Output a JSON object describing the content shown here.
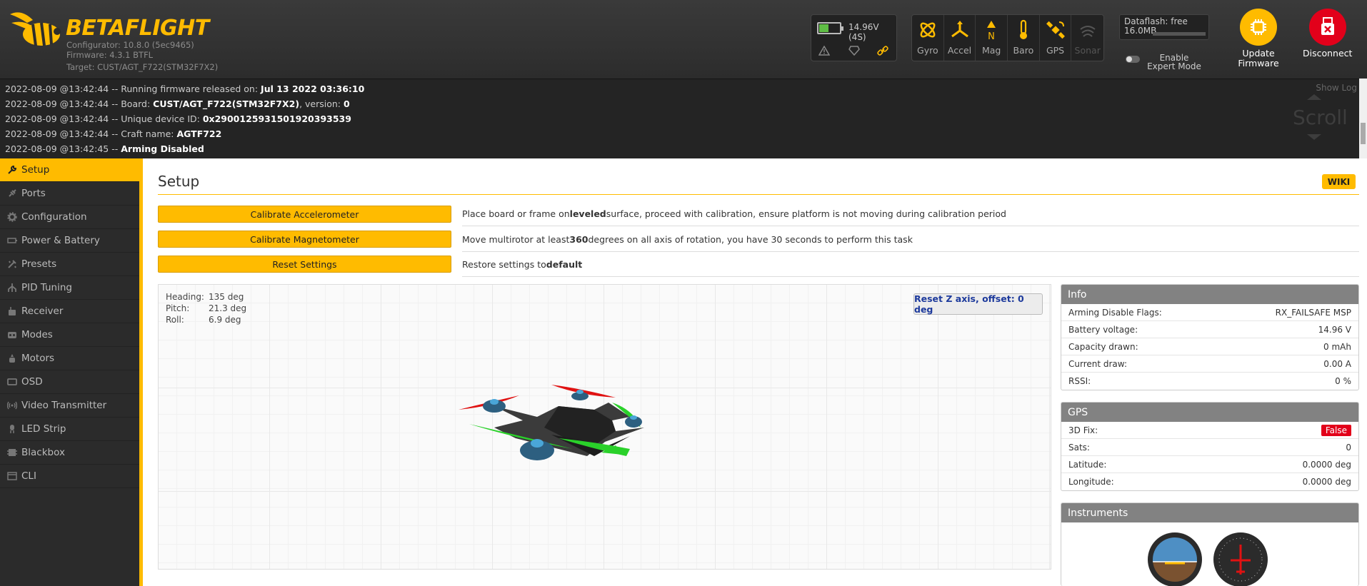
{
  "header": {
    "logo_name": "BETAFLIGHT",
    "configurator": "Configurator: 10.8.0 (5ec9465)",
    "firmware": "Firmware: 4.3.1 BTFL",
    "target": "Target: CUST/AGT_F722(STM32F7X2)",
    "battery": "14.96V (4S)",
    "sensors": [
      {
        "label": "Gyro"
      },
      {
        "label": "Accel"
      },
      {
        "label": "Mag"
      },
      {
        "label": "Baro"
      },
      {
        "label": "GPS"
      },
      {
        "label": "Sonar"
      }
    ],
    "dataflash_label": "Dataflash: free",
    "dataflash_size": "16.0MB",
    "expert_mode": "Enable Expert Mode",
    "update_firmware": "Update Firmware",
    "disconnect": "Disconnect",
    "accent_color": "#ffbb00",
    "disconnect_color": "#e2001a"
  },
  "log": {
    "show_log": "Show Log",
    "scroll": "Scroll",
    "lines": [
      {
        "prefix": "2022-08-09 @13:42:44 -- Running firmware released on: ",
        "bold": "Jul 13 2022 03:36:10",
        "suffix": ""
      },
      {
        "prefix": "2022-08-09 @13:42:44 -- Board: ",
        "bold": "CUST/AGT_F722(STM32F7X2)",
        "suffix": ", version: ",
        "bold2": "0"
      },
      {
        "prefix": "2022-08-09 @13:42:44 -- Unique device ID: ",
        "bold": "0x290012593150192039353​9",
        "suffix": ""
      },
      {
        "prefix": "2022-08-09 @13:42:44 -- Craft name: ",
        "bold": "AGTF722",
        "suffix": ""
      },
      {
        "prefix": "2022-08-09 @13:42:45 -- ",
        "bold": "Arming Disabled",
        "suffix": ""
      }
    ]
  },
  "sidebar": {
    "items": [
      {
        "label": "Setup",
        "icon": "wrench-icon"
      },
      {
        "label": "Ports",
        "icon": "plug-icon"
      },
      {
        "label": "Configuration",
        "icon": "gear-icon"
      },
      {
        "label": "Power & Battery",
        "icon": "battery-icon"
      },
      {
        "label": "Presets",
        "icon": "presets-icon"
      },
      {
        "label": "PID Tuning",
        "icon": "pid-icon"
      },
      {
        "label": "Receiver",
        "icon": "receiver-icon"
      },
      {
        "label": "Modes",
        "icon": "modes-icon"
      },
      {
        "label": "Motors",
        "icon": "motor-icon"
      },
      {
        "label": "OSD",
        "icon": "osd-icon"
      },
      {
        "label": "Video Transmitter",
        "icon": "antenna-icon"
      },
      {
        "label": "LED Strip",
        "icon": "led-icon"
      },
      {
        "label": "Blackbox",
        "icon": "blackbox-icon"
      },
      {
        "label": "CLI",
        "icon": "terminal-icon"
      }
    ]
  },
  "setup": {
    "title": "Setup",
    "wiki": "WIKI",
    "buttons": [
      {
        "label": "Calibrate Accelerometer",
        "desc_pre": "Place board or frame on ",
        "desc_bold": "leveled",
        "desc_post": " surface, proceed with calibration, ensure platform is not moving during calibration period"
      },
      {
        "label": "Calibrate Magnetometer",
        "desc_pre": "Move multirotor at least ",
        "desc_bold": "360",
        "desc_post": " degrees on all axis of rotation, you have 30 seconds to perform this task"
      },
      {
        "label": "Reset Settings",
        "desc_pre": "Restore settings to ",
        "desc_bold": "default",
        "desc_post": ""
      }
    ],
    "attitude": [
      {
        "label": "Heading:",
        "value": "135 deg"
      },
      {
        "label": "Pitch:",
        "value": "21.3 deg"
      },
      {
        "label": "Roll:",
        "value": "6.9 deg"
      }
    ],
    "reset_z": "Reset Z axis, offset: 0 deg"
  },
  "info": {
    "title": "Info",
    "rows": [
      {
        "label": "Arming Disable Flags:",
        "value": "RX_FAILSAFE  MSP"
      },
      {
        "label": "Battery voltage:",
        "value": "14.96 V"
      },
      {
        "label": "Capacity drawn:",
        "value": "0 mAh"
      },
      {
        "label": "Current draw:",
        "value": "0.00 A"
      },
      {
        "label": "RSSI:",
        "value": "0 %"
      }
    ]
  },
  "gps": {
    "title": "GPS",
    "fix_label": "3D Fix:",
    "fix_value": "False",
    "rows": [
      {
        "label": "Sats:",
        "value": "0"
      },
      {
        "label": "Latitude:",
        "value": "0.0000 deg"
      },
      {
        "label": "Longitude:",
        "value": "0.0000 deg"
      }
    ]
  },
  "instruments": {
    "title": "Instruments"
  }
}
